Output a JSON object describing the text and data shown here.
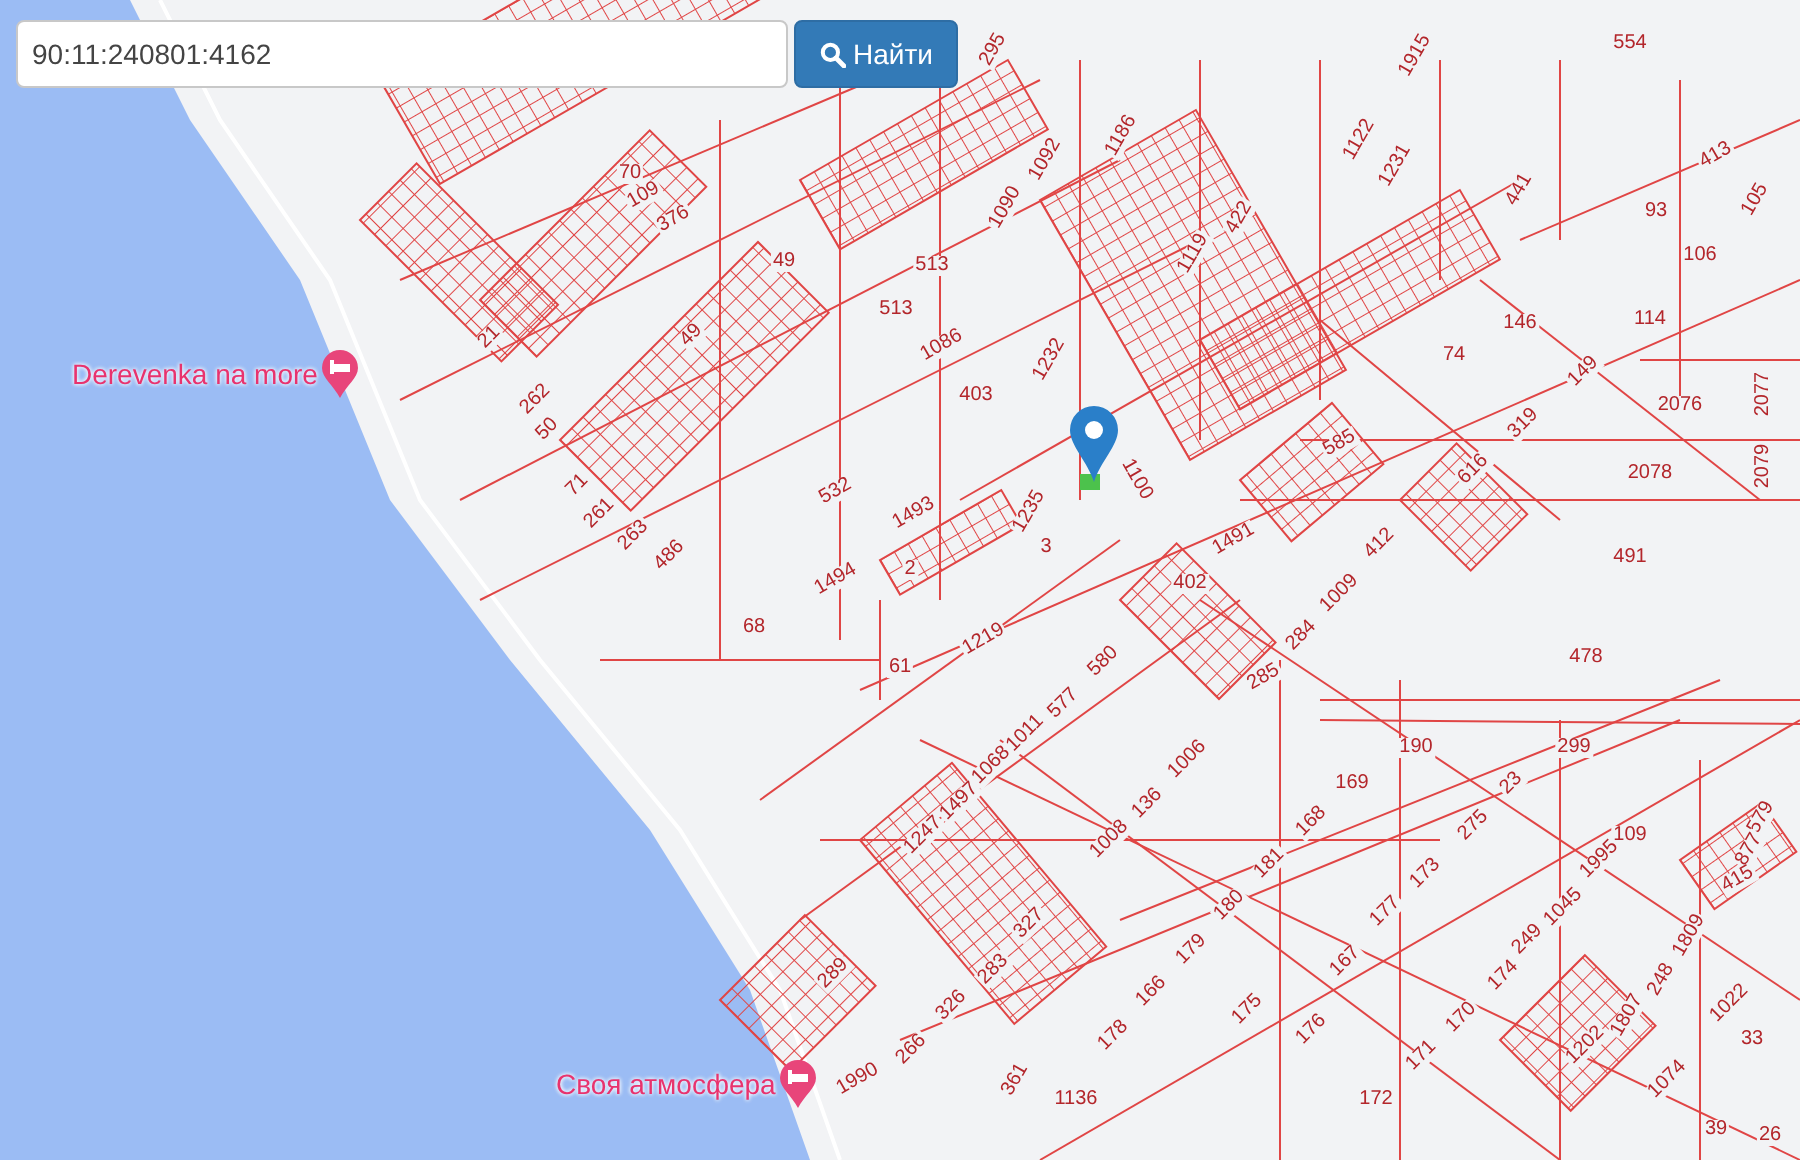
{
  "search": {
    "value": "90:11:240801:4162"
  },
  "search_button": {
    "label": "Найти"
  },
  "places": [
    {
      "name": "Derevenka na more"
    },
    {
      "name": "Своя атмосфера"
    }
  ],
  "parcels": [
    "554",
    "1915",
    "1122",
    "1231",
    "441",
    "93",
    "413",
    "105",
    "106",
    "146",
    "114",
    "74",
    "149",
    "319",
    "616",
    "2076",
    "2077",
    "2078",
    "2079",
    "491",
    "478",
    "585",
    "412",
    "1491",
    "1009",
    "402",
    "284",
    "285",
    "580",
    "577",
    "1011",
    "1068",
    "1497",
    "1247",
    "1006",
    "136",
    "1008",
    "327",
    "283",
    "326",
    "266",
    "289",
    "1990",
    "361",
    "1136",
    "178",
    "166",
    "179",
    "180",
    "181",
    "168",
    "169",
    "190",
    "23",
    "299",
    "275",
    "173",
    "177",
    "167",
    "175",
    "176",
    "174",
    "170",
    "171",
    "172",
    "1202",
    "109",
    "1995",
    "1045",
    "249",
    "1809",
    "248",
    "1807",
    "1022",
    "1074",
    "33",
    "39",
    "26",
    "579",
    "877",
    "415",
    "70",
    "109",
    "376",
    "49",
    "49",
    "21",
    "262",
    "50",
    "71",
    "261",
    "263",
    "486",
    "532",
    "1493",
    "1494",
    "2",
    "68",
    "61",
    "1219",
    "513",
    "513",
    "1086",
    "403",
    "1232",
    "1090",
    "1092",
    "1186",
    "1119",
    "422",
    "1100",
    "1235",
    "3",
    "295"
  ]
}
